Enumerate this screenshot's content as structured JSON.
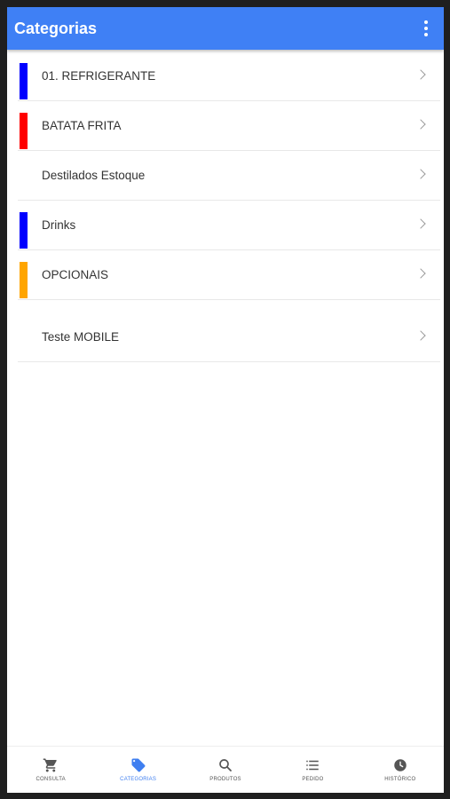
{
  "app_bar": {
    "title": "Categorias",
    "menu_icon": "more-vert-icon"
  },
  "categories": [
    {
      "label": "01. REFRIGERANTE",
      "color": "#0000ff"
    },
    {
      "label": "BATATA FRITA",
      "color": "#ff0000"
    },
    {
      "label": "Destilados Estoque",
      "color": ""
    },
    {
      "label": "Drinks",
      "color": "#0000ff"
    },
    {
      "label": "OPCIONAIS",
      "color": "#ffa500"
    },
    {
      "label": "Teste MOBILE",
      "color": ""
    }
  ],
  "bottom_nav": {
    "active": "CATEGORIAS",
    "active_color": "#3f7ff0",
    "items": [
      {
        "label": "CONSULTA",
        "icon": "cart-icon"
      },
      {
        "label": "CATEGORIAS",
        "icon": "tag-icon"
      },
      {
        "label": "PRODUTOS",
        "icon": "search-icon"
      },
      {
        "label": "PEDIDO",
        "icon": "list-icon"
      },
      {
        "label": "HISTÓRICO",
        "icon": "clock-icon"
      }
    ]
  }
}
